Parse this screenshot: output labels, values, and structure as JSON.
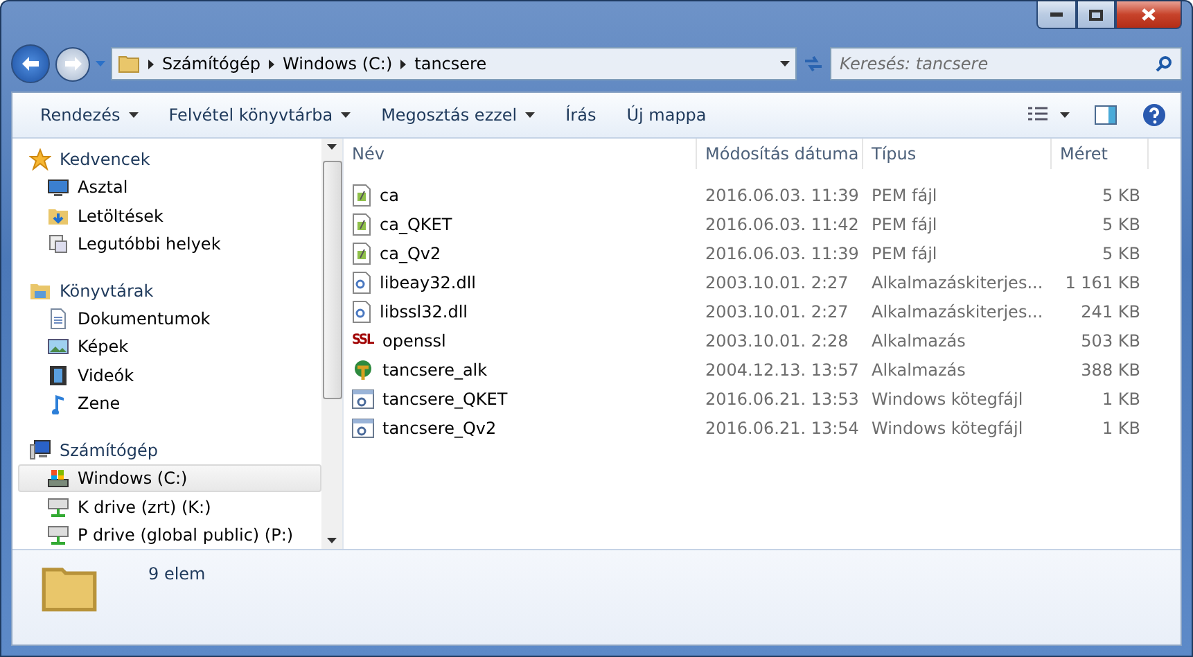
{
  "breadcrumb": [
    "Számítógép",
    "Windows (C:)",
    "tancsere"
  ],
  "search": {
    "placeholder": "Keresés: tancsere"
  },
  "toolbar": [
    {
      "label": "Rendezés",
      "dropdown": true
    },
    {
      "label": "Felvétel könyvtárba",
      "dropdown": true
    },
    {
      "label": "Megosztás ezzel",
      "dropdown": true
    },
    {
      "label": "Írás",
      "dropdown": false
    },
    {
      "label": "Új mappa",
      "dropdown": false
    }
  ],
  "sidebar": {
    "groups": [
      {
        "label": "Kedvencek",
        "kind": "star",
        "items": [
          {
            "label": "Asztal",
            "kind": "desktop",
            "selected": false
          },
          {
            "label": "Letöltések",
            "kind": "download",
            "selected": false
          },
          {
            "label": "Legutóbbi helyek",
            "kind": "recent",
            "selected": false
          }
        ]
      },
      {
        "label": "Könyvtárak",
        "kind": "library",
        "items": [
          {
            "label": "Dokumentumok",
            "kind": "doc",
            "selected": false
          },
          {
            "label": "Képek",
            "kind": "image",
            "selected": false
          },
          {
            "label": "Videók",
            "kind": "video",
            "selected": false
          },
          {
            "label": "Zene",
            "kind": "music",
            "selected": false
          }
        ]
      },
      {
        "label": "Számítógép",
        "kind": "computer",
        "items": [
          {
            "label": "Windows (C:)",
            "kind": "drive",
            "selected": true
          },
          {
            "label": "K drive (zrt) (K:)",
            "kind": "net",
            "selected": false
          },
          {
            "label": "P drive (global public) (P:)",
            "kind": "net",
            "selected": false
          }
        ]
      }
    ]
  },
  "table": {
    "columns": [
      "Név",
      "Módosítás dátuma",
      "Típus",
      "Méret"
    ],
    "rows": [
      {
        "name": "ca",
        "kind": "pem",
        "date": "2016.06.03. 11:39",
        "type": "PEM fájl",
        "size": "5 KB"
      },
      {
        "name": "ca_QKET",
        "kind": "pem",
        "date": "2016.06.03. 11:42",
        "type": "PEM fájl",
        "size": "5 KB"
      },
      {
        "name": "ca_Qv2",
        "kind": "pem",
        "date": "2016.06.03. 11:39",
        "type": "PEM fájl",
        "size": "5 KB"
      },
      {
        "name": "libeay32.dll",
        "kind": "dll",
        "date": "2003.10.01. 2:27",
        "type": "Alkalmazáskiterjes...",
        "size": "1 161 KB"
      },
      {
        "name": "libssl32.dll",
        "kind": "dll",
        "date": "2003.10.01. 2:27",
        "type": "Alkalmazáskiterjes...",
        "size": "241 KB"
      },
      {
        "name": "openssl",
        "kind": "ssl",
        "icon_text": "SSL",
        "date": "2003.10.01. 2:28",
        "type": "Alkalmazás",
        "size": "503 KB"
      },
      {
        "name": "tancsere_alk",
        "kind": "app",
        "date": "2004.12.13. 13:57",
        "type": "Alkalmazás",
        "size": "388 KB"
      },
      {
        "name": "tancsere_QKET",
        "kind": "bat",
        "date": "2016.06.21. 13:53",
        "type": "Windows kötegfájl",
        "size": "1 KB"
      },
      {
        "name": "tancsere_Qv2",
        "kind": "bat",
        "date": "2016.06.21. 13:54",
        "type": "Windows kötegfájl",
        "size": "1 KB"
      }
    ]
  },
  "status_bar": {
    "count": "9 elem"
  }
}
